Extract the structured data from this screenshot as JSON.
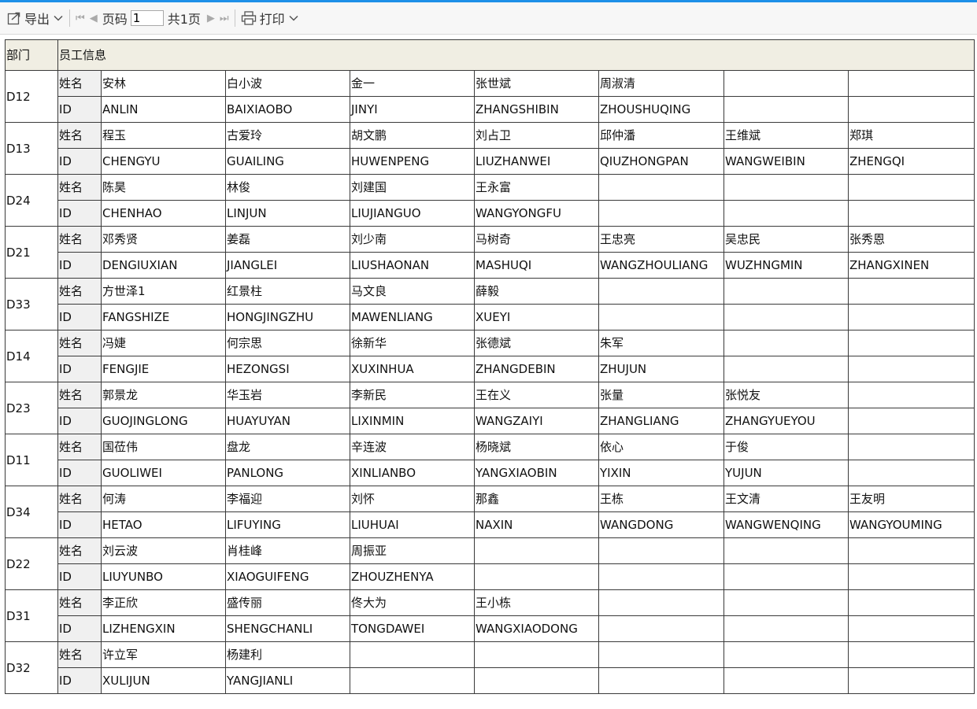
{
  "toolbar": {
    "export_label": "导出",
    "page_label": "页码",
    "page_value": "1",
    "total_label": "共1页",
    "print_label": "打印"
  },
  "table": {
    "header_dept": "部门",
    "header_info": "员工信息",
    "name_label": "姓名",
    "id_label": "ID",
    "departments": [
      {
        "dept": "D12",
        "names": [
          "安林",
          "白小波",
          "金一",
          "张世斌",
          "周淑清",
          "",
          ""
        ],
        "ids": [
          "ANLIN",
          "BAIXIAOBO",
          "JINYI",
          "ZHANGSHIBIN",
          "ZHOUSHUQING",
          "",
          ""
        ]
      },
      {
        "dept": "D13",
        "names": [
          "程玉",
          "古爱玲",
          "胡文鹏",
          "刘占卫",
          "邱仲潘",
          "王维斌",
          "郑琪"
        ],
        "ids": [
          "CHENGYU",
          "GUAILING",
          "HUWENPENG",
          "LIUZHANWEI",
          "QIUZHONGPAN",
          "WANGWEIBIN",
          "ZHENGQI"
        ]
      },
      {
        "dept": "D24",
        "names": [
          "陈昊",
          "林俊",
          "刘建国",
          "王永富",
          "",
          "",
          ""
        ],
        "ids": [
          "CHENHAO",
          "LINJUN",
          "LIUJIANGUO",
          "WANGYONGFU",
          "",
          "",
          ""
        ]
      },
      {
        "dept": "D21",
        "names": [
          "邓秀贤",
          "姜磊",
          "刘少南",
          "马树奇",
          "王忠亮",
          "吴忠民",
          "张秀恩"
        ],
        "ids": [
          "DENGIUXIAN",
          "JIANGLEI",
          "LIUSHAONAN",
          "MASHUQI",
          "WANGZHOULIANG",
          "WUZHNGMIN",
          "ZHANGXINEN"
        ]
      },
      {
        "dept": "D33",
        "names": [
          "方世泽1",
          "红景柱",
          "马文良",
          "薛毅",
          "",
          "",
          ""
        ],
        "ids": [
          "FANGSHIZE",
          "HONGJINGZHU",
          "MAWENLIANG",
          "XUEYI",
          "",
          "",
          ""
        ]
      },
      {
        "dept": "D14",
        "names": [
          "冯婕",
          "何宗思",
          "徐新华",
          "张德斌",
          "朱军",
          "",
          ""
        ],
        "ids": [
          "FENGJIE",
          "HEZONGSI",
          "XUXINHUA",
          "ZHANGDEBIN",
          "ZHUJUN",
          "",
          ""
        ]
      },
      {
        "dept": "D23",
        "names": [
          "郭景龙",
          "华玉岩",
          "李新民",
          "王在义",
          "张量",
          "张悦友",
          ""
        ],
        "ids": [
          "GUOJINGLONG",
          "HUAYUYAN",
          "LIXINMIN",
          "WANGZAIYI",
          "ZHANGLIANG",
          "ZHANGYUEYOU",
          ""
        ]
      },
      {
        "dept": "D11",
        "names": [
          "国莅伟",
          "盘龙",
          "辛连波",
          "杨晓斌",
          "依心",
          "于俊",
          ""
        ],
        "ids": [
          "GUOLIWEI",
          "PANLONG",
          "XINLIANBO",
          "YANGXIAOBIN",
          "YIXIN",
          "YUJUN",
          ""
        ]
      },
      {
        "dept": "D34",
        "names": [
          "何涛",
          "李福迎",
          "刘怀",
          "那鑫",
          "王栋",
          "王文清",
          "王友明"
        ],
        "ids": [
          "HETAO",
          "LIFUYING",
          "LIUHUAI",
          "NAXIN",
          "WANGDONG",
          "WANGWENQING",
          "WANGYOUMING"
        ]
      },
      {
        "dept": "D22",
        "names": [
          "刘云波",
          "肖桂峰",
          "周振亚",
          "",
          "",
          "",
          ""
        ],
        "ids": [
          "LIUYUNBO",
          "XIAOGUIFENG",
          "ZHOUZHENYA",
          "",
          "",
          "",
          ""
        ]
      },
      {
        "dept": "D31",
        "names": [
          "李正欣",
          "盛传丽",
          "佟大为",
          "王小栋",
          "",
          "",
          ""
        ],
        "ids": [
          "LIZHENGXIN",
          "SHENGCHANLI",
          "TONGDAWEI",
          "WANGXIAODONG",
          "",
          "",
          ""
        ]
      },
      {
        "dept": "D32",
        "names": [
          "许立军",
          "杨建利",
          "",
          "",
          "",
          "",
          ""
        ],
        "ids": [
          "XULIJUN",
          "YANGJIANLI",
          "",
          "",
          "",
          "",
          ""
        ]
      }
    ]
  }
}
